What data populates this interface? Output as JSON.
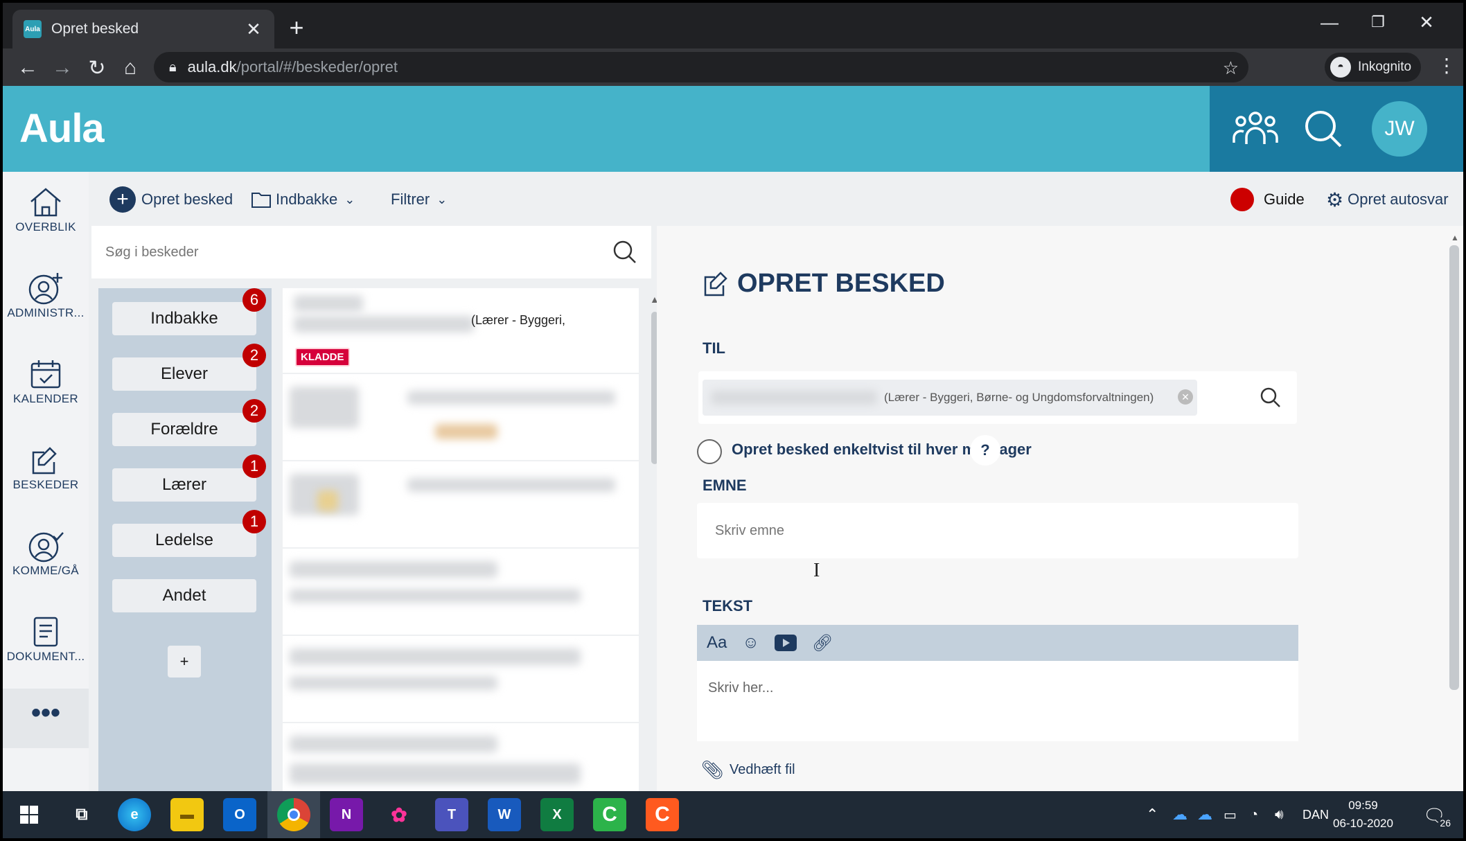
{
  "browser": {
    "tab_title": "Opret besked",
    "tab_favicon_text": "Aula",
    "url_host": "aula.dk",
    "url_path": "/portal/#/beskeder/opret",
    "incognito_label": "Inkognito"
  },
  "header": {
    "logo": "Aula",
    "avatar_initials": "JW"
  },
  "rail": {
    "items": [
      {
        "label": "OVERBLIK",
        "icon": "home-icon"
      },
      {
        "label": "ADMINISTR...",
        "icon": "admin-user-icon"
      },
      {
        "label": "KALENDER",
        "icon": "calendar-icon"
      },
      {
        "label": "BESKEDER",
        "icon": "edit-message-icon"
      },
      {
        "label": "KOMME/GÅ",
        "icon": "checkin-icon"
      },
      {
        "label": "DOKUMENT...",
        "icon": "document-icon"
      }
    ],
    "more": "•••"
  },
  "toolbar": {
    "new_message": "Opret besked",
    "inbox": "Indbakke",
    "filter": "Filtrer",
    "guide": "Guide",
    "autoreply": "Opret autosvar"
  },
  "search": {
    "placeholder": "Søg i beskeder"
  },
  "folders": {
    "items": [
      {
        "label": "Indbakke",
        "badge": "6"
      },
      {
        "label": "Elever",
        "badge": "2"
      },
      {
        "label": "Forældre",
        "badge": "2"
      },
      {
        "label": "Lærer",
        "badge": "1"
      },
      {
        "label": "Ledelse",
        "badge": "1"
      },
      {
        "label": "Andet",
        "badge": ""
      }
    ],
    "add": "+"
  },
  "message_list": {
    "first_item_text": "(Lærer - Byggeri,",
    "first_item_tag": "KLADDE"
  },
  "compose": {
    "title": "OPRET BESKED",
    "to_label": "TIL",
    "recipient_chip": "(Lærer - Byggeri, Børne- og Ungdomsforvaltningen)",
    "individual_label": "Opret besked enkeltvist til hver modtager",
    "help": "?",
    "subject_label": "EMNE",
    "subject_placeholder": "Skriv emne",
    "text_label": "TEKST",
    "editor_font_btn": "Aa",
    "body_placeholder": "Skriv her...",
    "attach_label": "Vedhæft fil"
  },
  "taskbar": {
    "language": "DAN",
    "time": "09:59",
    "date": "06-10-2020",
    "notifications": "26"
  },
  "colors": {
    "aula_teal": "#45b3c9",
    "header_dark": "#1a7aa0",
    "navy": "#1e3a5f",
    "badge_red": "#c00000",
    "folder_panel": "#c3d0dc"
  }
}
